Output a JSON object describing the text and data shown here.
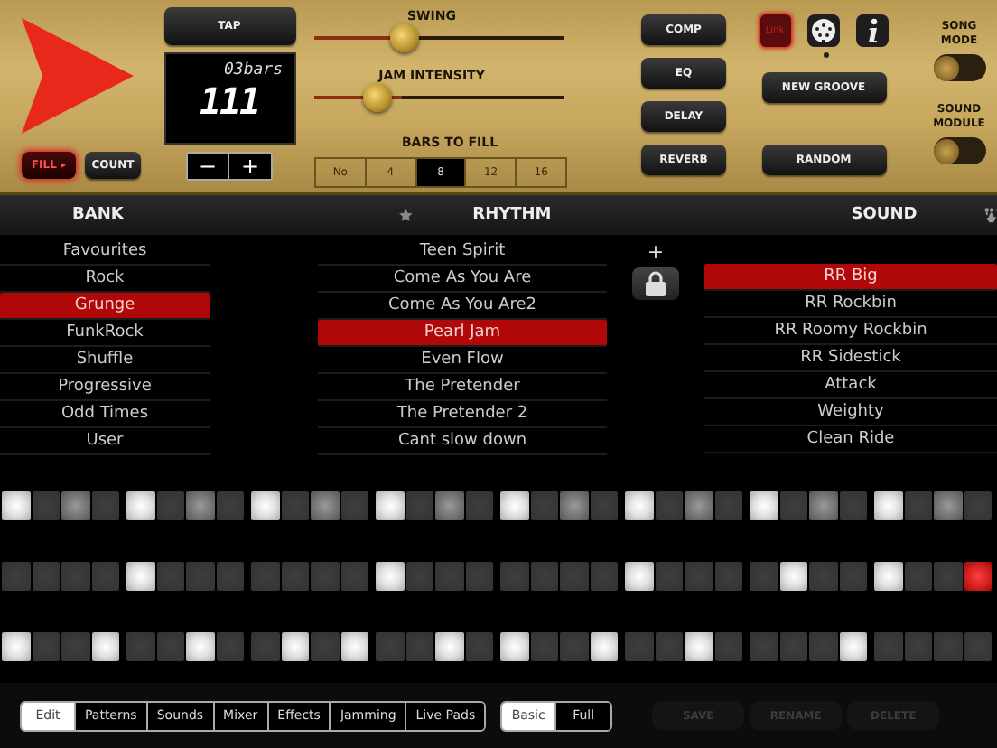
{
  "transport": {
    "fill_label": "FILL ▸",
    "fill_on": true,
    "count_label": "COUNT",
    "tap_label": "TAP",
    "display_top": "03bars",
    "display_main": "111",
    "minus": "−",
    "plus": "+"
  },
  "sliders": [
    {
      "label": "SWING",
      "level": 0.36
    },
    {
      "label": "JAM INTENSITY",
      "level": 0.25
    }
  ],
  "bars_to_fill": {
    "label": "BARS TO FILL",
    "options": [
      {
        "label": "No",
        "selected": false
      },
      {
        "label": "4",
        "selected": false
      },
      {
        "label": "8",
        "selected": true
      },
      {
        "label": "12",
        "selected": false
      },
      {
        "label": "16",
        "selected": false
      }
    ]
  },
  "effect_buttons": [
    "COMP",
    "EQ",
    "DELAY",
    "REVERB"
  ],
  "groove_buttons": [
    "NEW GROOVE",
    "RANDOM"
  ],
  "link": {
    "label": "Link",
    "on": true
  },
  "toggles": [
    {
      "label": "SONG MODE",
      "on": false
    },
    {
      "label": "SOUND MODULE",
      "on": false
    }
  ],
  "headers": {
    "bank": "BANK",
    "rhythm": "RHYTHM",
    "sound": "SOUND"
  },
  "bank": [
    {
      "label": "Favourites",
      "selected": false
    },
    {
      "label": "Rock",
      "selected": false
    },
    {
      "label": "Grunge",
      "selected": true
    },
    {
      "label": "FunkRock",
      "selected": false
    },
    {
      "label": "Shuffle",
      "selected": false
    },
    {
      "label": "Progressive",
      "selected": false
    },
    {
      "label": "Odd Times",
      "selected": false
    },
    {
      "label": "User",
      "selected": false
    }
  ],
  "rhythm": [
    {
      "label": "Teen Spirit",
      "selected": false
    },
    {
      "label": "Come As You Are",
      "selected": false
    },
    {
      "label": "Come As You Are2",
      "selected": false
    },
    {
      "label": "Pearl Jam",
      "selected": true
    },
    {
      "label": "Even Flow",
      "selected": false
    },
    {
      "label": "The Pretender",
      "selected": false
    },
    {
      "label": "The Pretender 2",
      "selected": false
    },
    {
      "label": "Cant slow down",
      "selected": false
    }
  ],
  "add_label": "+",
  "sound": [
    {
      "label": "RR Big",
      "selected": true
    },
    {
      "label": "RR Rockbin",
      "selected": false
    },
    {
      "label": "RR Roomy Rockbin",
      "selected": false
    },
    {
      "label": "RR Sidestick",
      "selected": false
    },
    {
      "label": "Attack",
      "selected": false
    },
    {
      "label": "Weighty",
      "selected": false
    },
    {
      "label": "Clean Ride",
      "selected": false
    }
  ],
  "step_rows": [
    {
      "steps": [
        {
          "kind": "accent",
          "playing": false
        },
        {
          "kind": "rest",
          "playing": false
        },
        {
          "kind": "ghost",
          "playing": false
        },
        {
          "kind": "rest",
          "playing": false
        },
        {
          "kind": "accent",
          "playing": false
        },
        {
          "kind": "rest",
          "playing": false
        },
        {
          "kind": "ghost",
          "playing": false
        },
        {
          "kind": "rest",
          "playing": false
        },
        {
          "kind": "accent",
          "playing": false
        },
        {
          "kind": "rest",
          "playing": false
        },
        {
          "kind": "ghost",
          "playing": false
        },
        {
          "kind": "rest",
          "playing": false
        },
        {
          "kind": "accent",
          "playing": false
        },
        {
          "kind": "rest",
          "playing": false
        },
        {
          "kind": "ghost",
          "playing": false
        },
        {
          "kind": "rest",
          "playing": false
        },
        {
          "kind": "accent",
          "playing": false
        },
        {
          "kind": "rest",
          "playing": false
        },
        {
          "kind": "ghost",
          "playing": false
        },
        {
          "kind": "rest",
          "playing": false
        },
        {
          "kind": "accent",
          "playing": false
        },
        {
          "kind": "rest",
          "playing": false
        },
        {
          "kind": "ghost",
          "playing": false
        },
        {
          "kind": "rest",
          "playing": false
        },
        {
          "kind": "accent",
          "playing": false
        },
        {
          "kind": "rest",
          "playing": false
        },
        {
          "kind": "ghost",
          "playing": false
        },
        {
          "kind": "rest",
          "playing": false
        },
        {
          "kind": "accent",
          "playing": false
        },
        {
          "kind": "rest",
          "playing": false
        },
        {
          "kind": "ghost",
          "playing": false
        },
        {
          "kind": "rest",
          "playing": false
        }
      ]
    },
    {
      "steps": [
        {
          "kind": "rest",
          "playing": false
        },
        {
          "kind": "rest",
          "playing": false
        },
        {
          "kind": "rest",
          "playing": false
        },
        {
          "kind": "rest",
          "playing": false
        },
        {
          "kind": "accent",
          "playing": false
        },
        {
          "kind": "rest",
          "playing": false
        },
        {
          "kind": "rest",
          "playing": false
        },
        {
          "kind": "rest",
          "playing": false
        },
        {
          "kind": "rest",
          "playing": false
        },
        {
          "kind": "rest",
          "playing": false
        },
        {
          "kind": "rest",
          "playing": false
        },
        {
          "kind": "rest",
          "playing": false
        },
        {
          "kind": "accent",
          "playing": false
        },
        {
          "kind": "rest",
          "playing": false
        },
        {
          "kind": "rest",
          "playing": false
        },
        {
          "kind": "rest",
          "playing": false
        },
        {
          "kind": "rest",
          "playing": false
        },
        {
          "kind": "rest",
          "playing": false
        },
        {
          "kind": "rest",
          "playing": false
        },
        {
          "kind": "rest",
          "playing": false
        },
        {
          "kind": "accent",
          "playing": false
        },
        {
          "kind": "rest",
          "playing": false
        },
        {
          "kind": "rest",
          "playing": false
        },
        {
          "kind": "rest",
          "playing": false
        },
        {
          "kind": "rest",
          "playing": false
        },
        {
          "kind": "accent",
          "playing": false
        },
        {
          "kind": "rest",
          "playing": false
        },
        {
          "kind": "rest",
          "playing": false
        },
        {
          "kind": "accent",
          "playing": false
        },
        {
          "kind": "rest",
          "playing": false
        },
        {
          "kind": "rest",
          "playing": false
        },
        {
          "kind": "accent",
          "playing": true
        }
      ]
    },
    {
      "steps": [
        {
          "kind": "accent",
          "playing": false
        },
        {
          "kind": "rest",
          "playing": false
        },
        {
          "kind": "rest",
          "playing": false
        },
        {
          "kind": "accent",
          "playing": false
        },
        {
          "kind": "rest",
          "playing": false
        },
        {
          "kind": "rest",
          "playing": false
        },
        {
          "kind": "accent",
          "playing": false
        },
        {
          "kind": "rest",
          "playing": false
        },
        {
          "kind": "rest",
          "playing": false
        },
        {
          "kind": "accent",
          "playing": false
        },
        {
          "kind": "rest",
          "playing": false
        },
        {
          "kind": "accent",
          "playing": false
        },
        {
          "kind": "rest",
          "playing": false
        },
        {
          "kind": "rest",
          "playing": false
        },
        {
          "kind": "accent",
          "playing": false
        },
        {
          "kind": "rest",
          "playing": false
        },
        {
          "kind": "accent",
          "playing": false
        },
        {
          "kind": "rest",
          "playing": false
        },
        {
          "kind": "rest",
          "playing": false
        },
        {
          "kind": "accent",
          "playing": false
        },
        {
          "kind": "rest",
          "playing": false
        },
        {
          "kind": "rest",
          "playing": false
        },
        {
          "kind": "accent",
          "playing": false
        },
        {
          "kind": "rest",
          "playing": false
        },
        {
          "kind": "rest",
          "playing": false
        },
        {
          "kind": "rest",
          "playing": false
        },
        {
          "kind": "rest",
          "playing": false
        },
        {
          "kind": "accent",
          "playing": false
        },
        {
          "kind": "rest",
          "playing": false
        },
        {
          "kind": "rest",
          "playing": false
        },
        {
          "kind": "rest",
          "playing": false
        },
        {
          "kind": "rest",
          "playing": false
        }
      ]
    }
  ],
  "mode_tabs": [
    {
      "label": "Edit",
      "selected": true
    },
    {
      "label": "Patterns",
      "selected": false
    },
    {
      "label": "Sounds",
      "selected": false
    },
    {
      "label": "Mixer",
      "selected": false
    },
    {
      "label": "Effects",
      "selected": false
    },
    {
      "label": "Jamming",
      "selected": false
    },
    {
      "label": "Live Pads",
      "selected": false
    }
  ],
  "view_tabs": [
    {
      "label": "Basic",
      "selected": true
    },
    {
      "label": "Full",
      "selected": false
    }
  ],
  "actions": [
    {
      "label": "SAVE",
      "disabled": true
    },
    {
      "label": "RENAME",
      "disabled": true
    },
    {
      "label": "DELETE",
      "disabled": true
    }
  ]
}
